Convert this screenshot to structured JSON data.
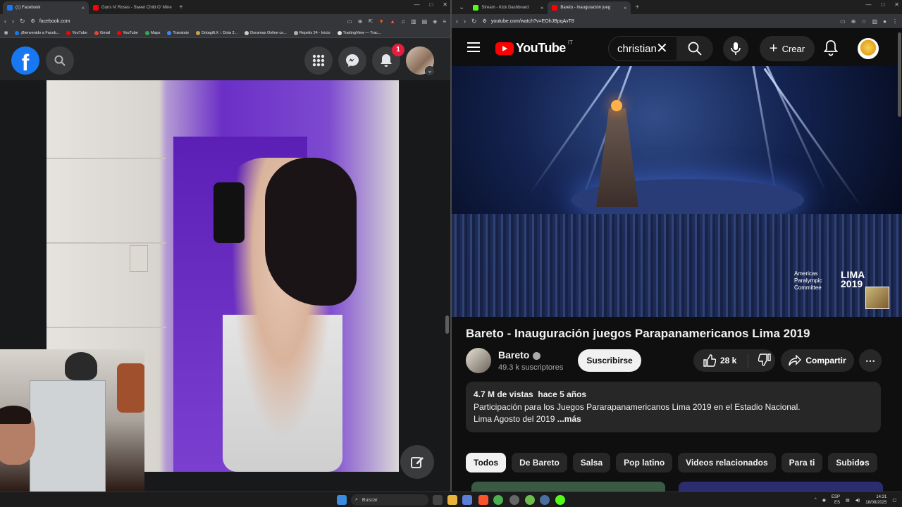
{
  "left_browser": {
    "tabs": [
      {
        "title": "(1) Facebook",
        "favicon_color": "#1877f2",
        "active": true
      },
      {
        "title": "Guns N' Roses - Sweet Child O' Mine",
        "favicon_color": "#ff0000",
        "active": false
      }
    ],
    "url": "facebook.com",
    "bookmarks": [
      {
        "label": "¡Bienvenido a Faceb...",
        "color": "#1877f2"
      },
      {
        "label": "YouTube",
        "color": "#ff0000"
      },
      {
        "label": "Gmail",
        "color": "#ea4335"
      },
      {
        "label": "YouTube",
        "color": "#ff0000"
      },
      {
        "label": "Maps",
        "color": "#34a853"
      },
      {
        "label": "Translate",
        "color": "#4285f4"
      },
      {
        "label": "Dotagift.X :: Dota 2...",
        "color": "#c8a24a"
      },
      {
        "label": "Doramas Online co...",
        "color": "#cccccc"
      },
      {
        "label": "Repelis 24 - Inicio",
        "color": "#b0b0b0"
      },
      {
        "label": "TradingView — Trac...",
        "color": "#e0e0e0"
      }
    ]
  },
  "facebook": {
    "notification_count": "1",
    "icons": [
      "facebook-logo",
      "search-icon",
      "menu-grid-icon",
      "messenger-icon",
      "bell-icon",
      "compose-icon"
    ]
  },
  "right_browser": {
    "tabs": [
      {
        "title": "Stream - Kick Dashboard",
        "favicon_color": "#53fc18",
        "active": false
      },
      {
        "title": "Bareto - Inauguración jueg",
        "favicon_color": "#ff0000",
        "active": true
      }
    ],
    "url": "youtube.com/watch?v=EOhJBpqAvT8"
  },
  "youtube": {
    "logo_text": "YouTube",
    "country_code": "IT",
    "search_value": "christian",
    "create_label": "Crear",
    "video_overlay": {
      "org_line1": "Americas",
      "org_line2": "Paralympic",
      "org_line3": "Committee",
      "event_line1": "LIMA",
      "event_line2": "2019"
    },
    "title": "Bareto - Inauguración juegos Parapanamericanos Lima 2019",
    "channel": {
      "name": "Bareto",
      "subscribers": "49.3 k suscriptores"
    },
    "subscribe_label": "Suscribirse",
    "likes": "28 k",
    "share_label": "Compartir",
    "description": {
      "views": "4.7 M de vistas",
      "age": "hace 5 años",
      "line1": "Participación para los Juegos Pararapanamericanos Lima 2019 en el Estadio Nacional.",
      "line2": "Lima Agosto del 2019",
      "more": "...más"
    },
    "chips": [
      "Todos",
      "De Bareto",
      "Salsa",
      "Pop latino",
      "Videos relacionados",
      "Para ti",
      "Subidos"
    ]
  },
  "taskbar": {
    "search_placeholder": "Buscar",
    "lang_line1": "ESP",
    "lang_line2": "ES",
    "time": "14:31",
    "date": "18/08/2025"
  }
}
